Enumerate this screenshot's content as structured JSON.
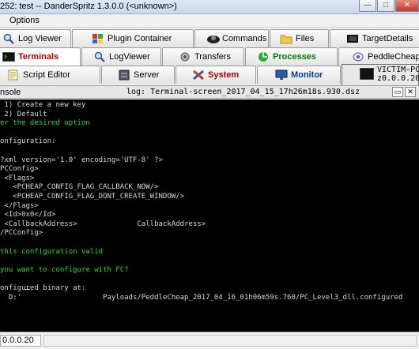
{
  "window": {
    "title": "252: test -- DanderSpritz 1.3.0.0 (<unknown>)",
    "minimize": "—",
    "maximize": "□",
    "close": "✕"
  },
  "menu": {
    "options": "Options"
  },
  "tabs": {
    "row1": [
      {
        "label": "Log Viewer",
        "icon": "magnifier-icon"
      },
      {
        "label": "Plugin Container",
        "icon": "puzzle-icon"
      },
      {
        "label": "Commands",
        "icon": "commands-icon"
      },
      {
        "label": "Files",
        "icon": "folder-icon"
      },
      {
        "label": "TargetDetails",
        "icon": "target-details-icon"
      }
    ],
    "row2": [
      {
        "label": "Terminals",
        "icon": "terminal-icon"
      },
      {
        "label": "LogViewer",
        "icon": "magnifier-icon"
      },
      {
        "label": "Transfers",
        "icon": "transfers-icon"
      },
      {
        "label": "Processes",
        "icon": "processes-icon"
      },
      {
        "label": "PeddleCheap",
        "icon": "peddlecheap-icon"
      }
    ],
    "row3": [
      {
        "label": "Script Editor",
        "icon": "script-editor-icon"
      },
      {
        "label": "Server",
        "icon": "server-icon"
      },
      {
        "label": "System",
        "icon": "tools-icon"
      },
      {
        "label": "Monitor",
        "icon": "monitor-icon"
      }
    ],
    "victim": {
      "line1": "VICTIM-PC",
      "line2": "z0.0.0.20",
      "icon": "terminal-icon"
    }
  },
  "subbar": {
    "left": "nsole",
    "log_name": "log: Terminal-screen_2017_04_15_17h26m18s.930.dsz"
  },
  "console": {
    "lines": [
      {
        "text": " 1) Create a new key",
        "color": "white"
      },
      {
        "text": " 2) Default",
        "color": "white"
      },
      {
        "text": "er the desired option",
        "color": "green"
      },
      {
        "text": "",
        "color": "white"
      },
      {
        "text": "onfiguration:",
        "color": "white"
      },
      {
        "text": "",
        "color": "white"
      },
      {
        "text": "?xml version='1.0' encoding='UTF-8' ?>",
        "color": "white"
      },
      {
        "text": "PCConfig>",
        "color": "white"
      },
      {
        "text": " <Flags>",
        "color": "white"
      },
      {
        "text": "   <PCHEAP_CONFIG_FLAG_CALLBACK_NOW/>",
        "color": "white"
      },
      {
        "text": "   <PCHEAP_CONFIG_FLAG_DONT_CREATE_WINDOW/>",
        "color": "white"
      },
      {
        "text": " </Flags>",
        "color": "white"
      },
      {
        "text": " <Id>0x0</Id>",
        "color": "white"
      },
      {
        "text": " <CallbackAddress>              CallbackAddress>",
        "color": "white"
      },
      {
        "text": "/PCConfig>",
        "color": "white"
      },
      {
        "text": "",
        "color": "white"
      },
      {
        "text": "this configuration valid",
        "color": "green"
      },
      {
        "text": "",
        "color": "white"
      },
      {
        "text": "you want to configure with FC?",
        "color": "green"
      },
      {
        "text": "",
        "color": "white"
      },
      {
        "text": "onfigured binary at:",
        "color": "white"
      },
      {
        "text": "  D:'                   Payloads/PeddleCheap_2017_04_16_01h06m59s.760/PC_Level3_dll.configured",
        "color": "white"
      }
    ]
  },
  "status": {
    "ip": "0.0.0.20"
  }
}
